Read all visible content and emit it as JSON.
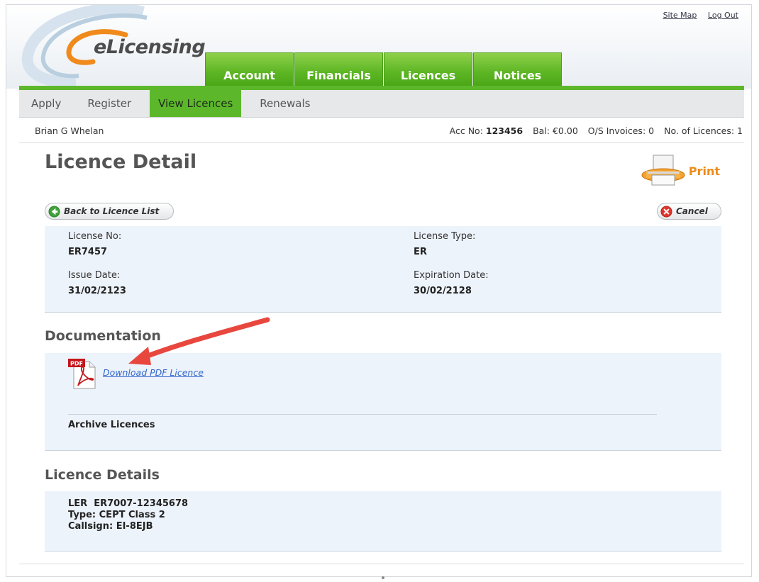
{
  "brand": {
    "logo_text": "eLicensing"
  },
  "toplinks": {
    "site_map": "Site Map",
    "log_out": "Log Out"
  },
  "main_tabs": [
    "Account",
    "Financials",
    "Licences",
    "Notices"
  ],
  "sub_nav": [
    "Apply",
    "Register",
    "View Licences",
    "Renewals"
  ],
  "sub_nav_active": "View Licences",
  "account": {
    "name": "Brian G Whelan",
    "acc_no_label": "Acc No:",
    "acc_no": "123456",
    "bal_label": "Bal:",
    "bal": "€0.00",
    "invoices_label": "O/S Invoices:",
    "invoices": "0",
    "licences_label": "No. of Licences:",
    "licences": "1"
  },
  "page": {
    "title": "Licence Detail",
    "print_label": "Print",
    "back_button": "Back to Licence List",
    "cancel_button": "Cancel"
  },
  "licence": {
    "license_no_label": "License No:",
    "license_no": "ER7457",
    "license_type_label": "License Type:",
    "license_type": "ER",
    "issue_date_label": "Issue Date:",
    "issue_date": "31/02/2123",
    "expiration_date_label": "Expiration Date:",
    "expiration_date": "30/02/2128"
  },
  "documentation": {
    "title": "Documentation",
    "pdf_badge": "PDF",
    "download_link": "Download PDF Licence",
    "archive_label": "Archive Licences"
  },
  "licence_details": {
    "title": "Licence Details",
    "line1": "LER  ER7007-12345678",
    "line2": "Type: CEPT Class 2",
    "line3": "Callsign: EI-8EJB"
  },
  "colors": {
    "tab_green": "#5cb82a",
    "print_orange": "#ee8a1a",
    "link_blue": "#3366cc",
    "arrow_red": "#e8473e"
  }
}
